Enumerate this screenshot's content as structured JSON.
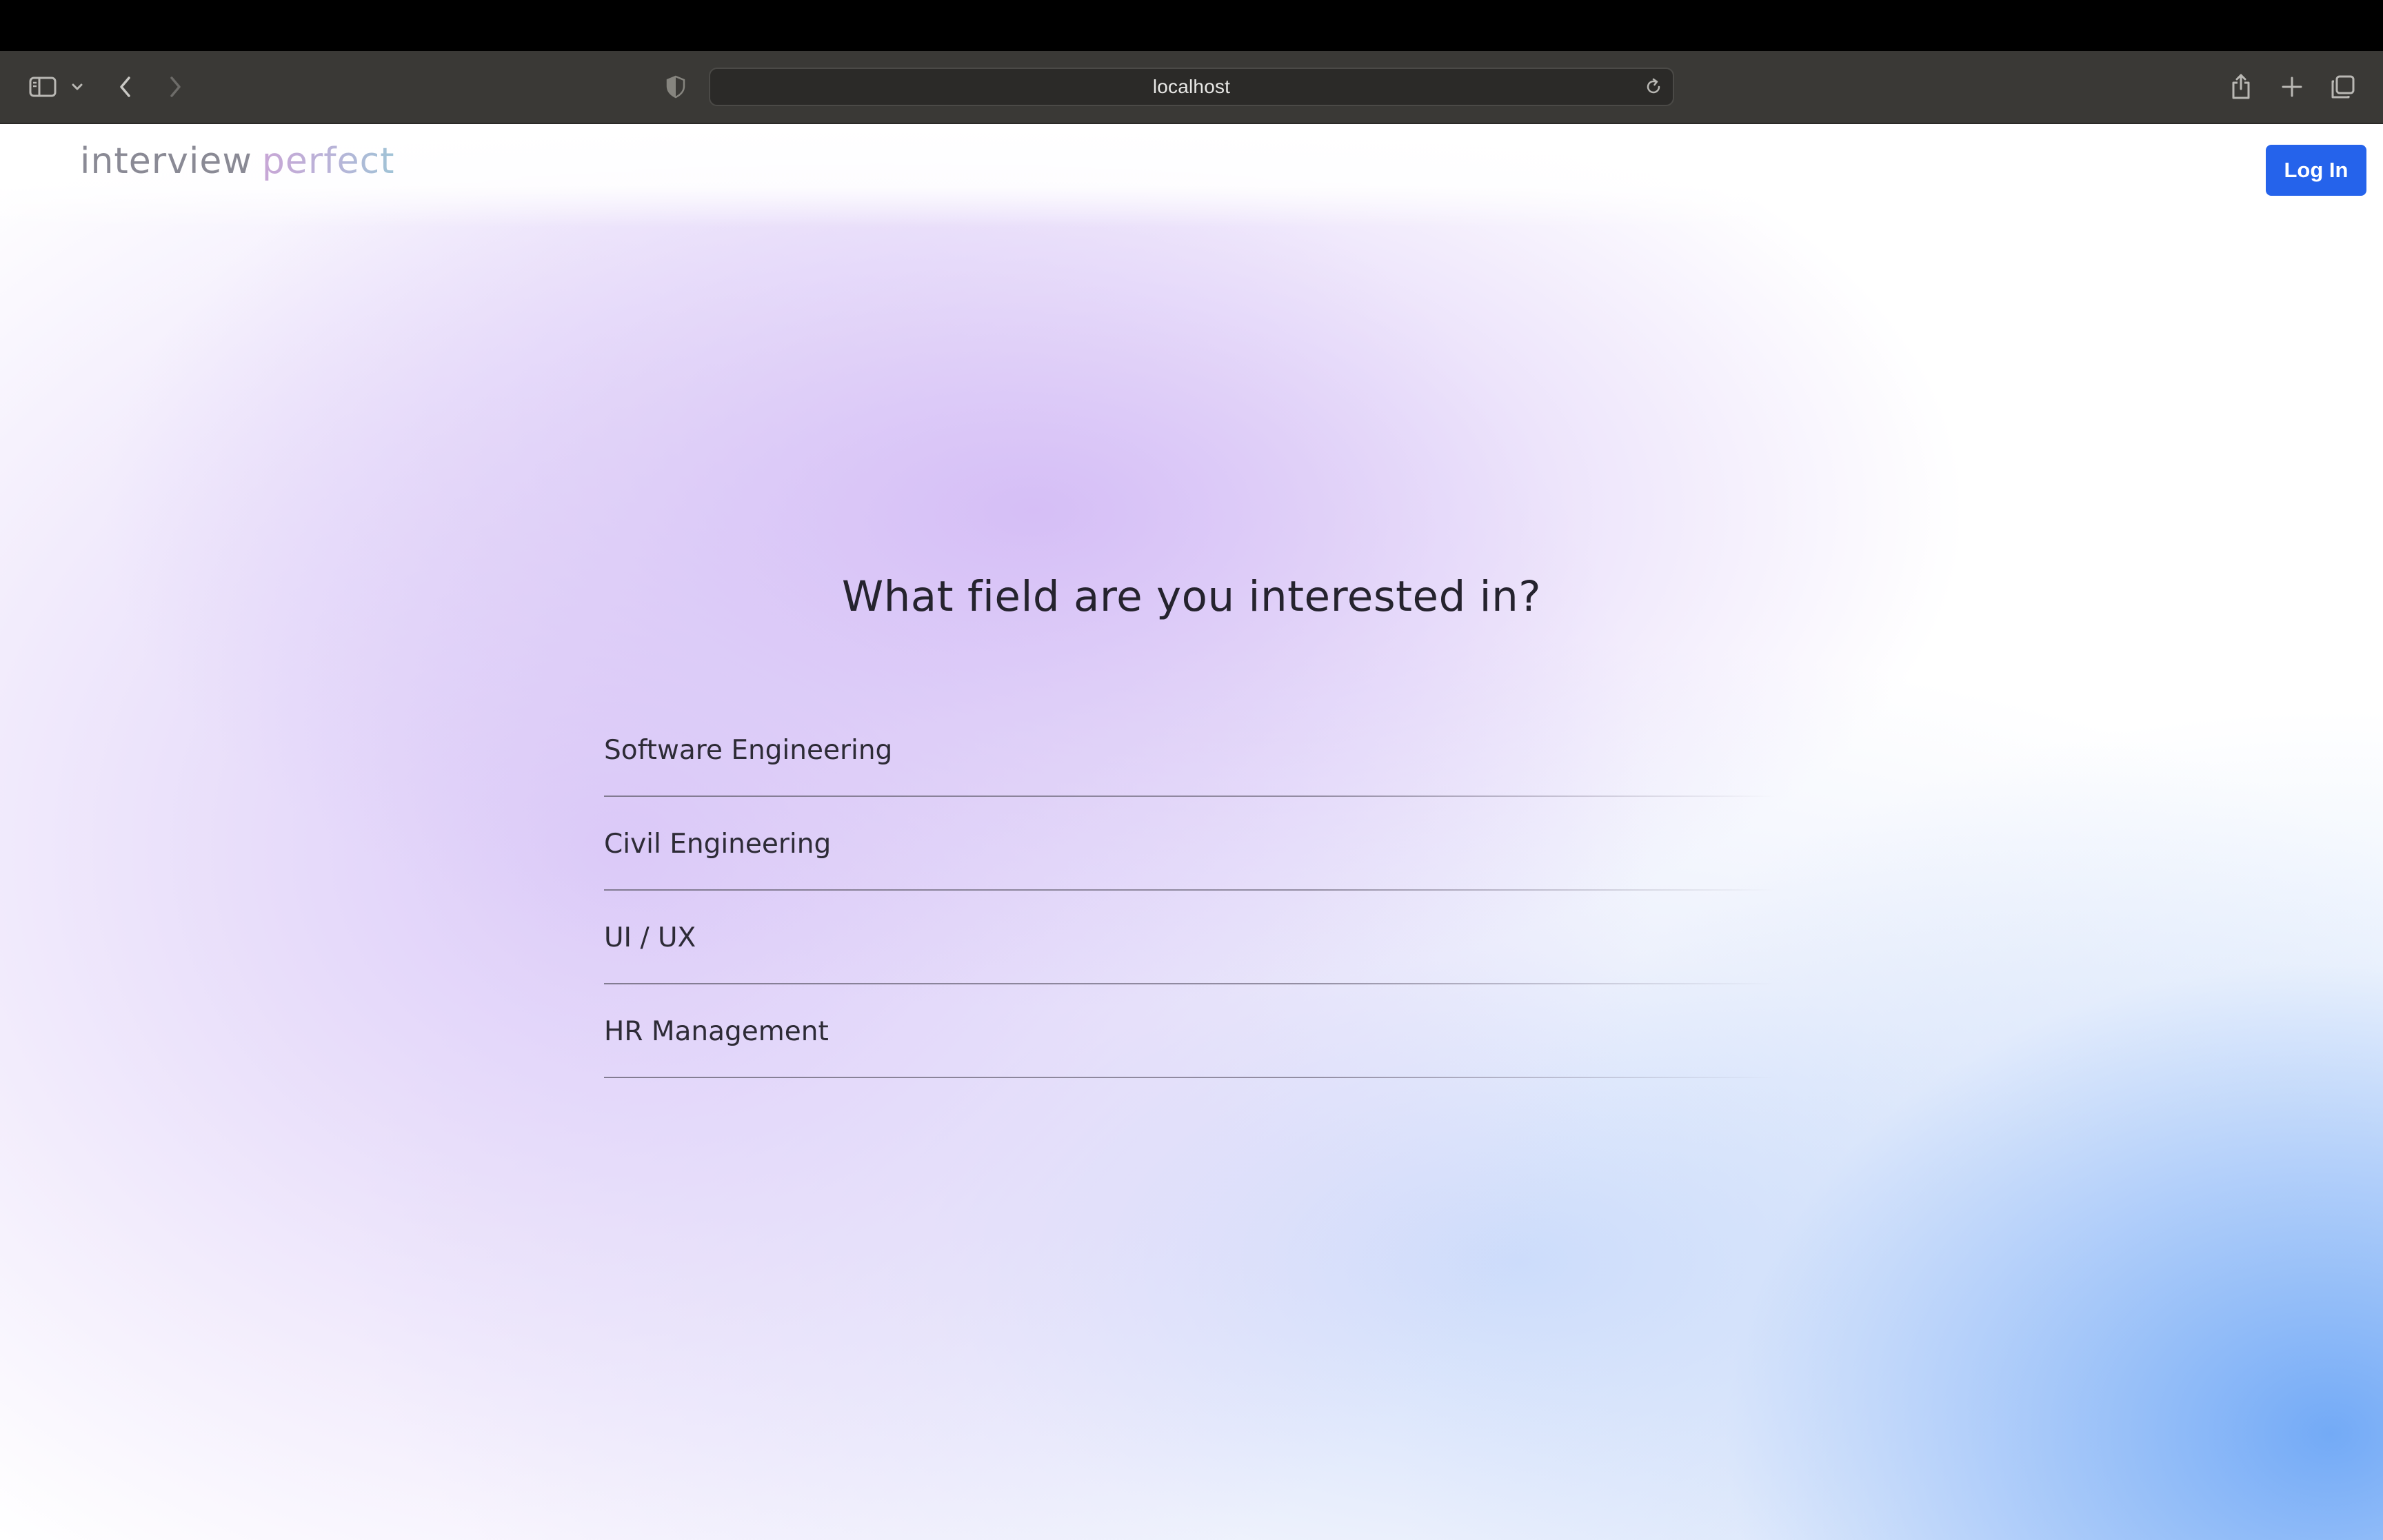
{
  "browser": {
    "url": "localhost",
    "icons": {
      "sidebar": "sidebar-icon",
      "sidebar_menu": "chevron-down-icon",
      "back": "chevron-left-icon",
      "forward": "chevron-right-icon",
      "privacy": "shield-icon",
      "reload": "reload-icon",
      "share": "share-icon",
      "new_tab": "plus-icon",
      "tabs": "tabs-overview-icon"
    }
  },
  "header": {
    "logo_part1": "interview",
    "logo_part2": "perfect",
    "login_label": "Log In",
    "login_color": "#2563eb"
  },
  "main": {
    "question": "What field are you interested in?",
    "options": [
      {
        "label": "Software Engineering"
      },
      {
        "label": "Civil Engineering"
      },
      {
        "label": "UI / UX"
      },
      {
        "label": "HR Management"
      }
    ]
  }
}
